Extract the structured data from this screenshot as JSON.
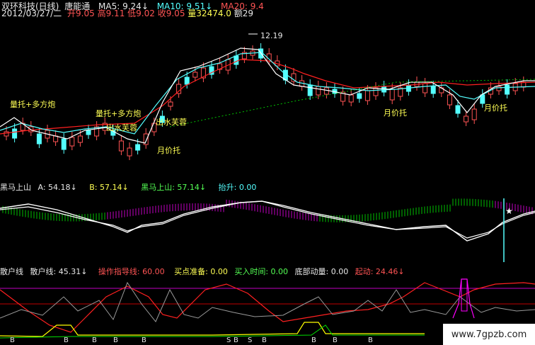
{
  "header": {
    "line1": {
      "title": "双环科技(日线)",
      "sub": "唐能通",
      "ma5": "MA5: 9.24↓",
      "ma10": "MA10: 9.51↓",
      "ma20": "MA20: 9.4"
    },
    "line2": {
      "date": "2012/03/27/二",
      "open": "开9.05",
      "high": "高9.11",
      "low": "低9.02",
      "close": "收9.05",
      "vol": "量32474.0",
      "amt": "额29"
    }
  },
  "main_chart": {
    "peak_label": "12.19",
    "annotations": [
      {
        "text": "量托+多方炮"
      },
      {
        "text": "量托+多方炮"
      },
      {
        "text": "出水芙蓉"
      },
      {
        "text": "出水芙蓉"
      },
      {
        "text": "月价托"
      },
      {
        "text": "月价托"
      },
      {
        "text": "月价托"
      }
    ]
  },
  "panel2": {
    "name": "黑马上山",
    "a": "A: 54.18↓",
    "b": "B: 57.14↓",
    "c": "黑马上山: 57.14↓",
    "d": "抬升: 0.00"
  },
  "panel3": {
    "name": "散户线",
    "sanhu": "散户线: 45.31↓",
    "guide": "操作指导线: 60.00",
    "ready": "买点准备: 0.00",
    "buytime": "买入时间: 0.00",
    "bottom": "底部动量: 0.00",
    "start": "起动: 24.46↓",
    "markers": [
      "B",
      "B",
      "B",
      "B",
      "B",
      "S",
      "B",
      "S",
      "B",
      "B",
      "B",
      "B"
    ]
  },
  "watermark": "www.7gpzb.com",
  "colors": {
    "up": "#ff5454",
    "down": "#54ffff",
    "ma5": "#ffffff",
    "ma10": "#ffff00",
    "ma20": "#ff0000",
    "green": "#00ff00",
    "magenta": "#ff00ff",
    "red": "#ff0000"
  }
}
